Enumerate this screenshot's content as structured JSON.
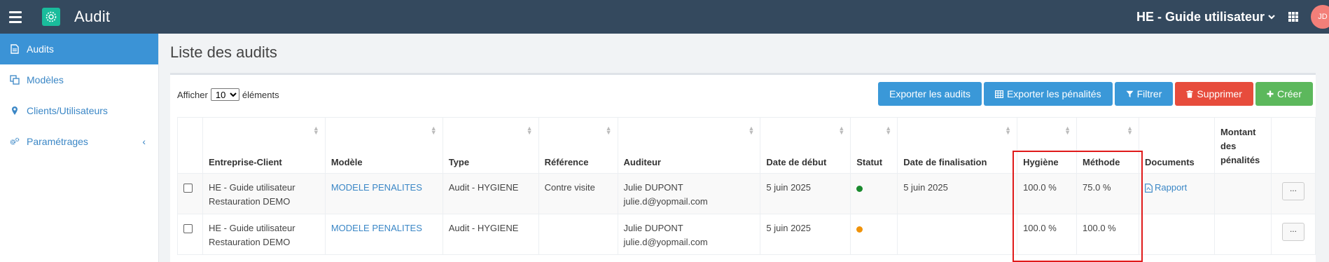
{
  "app": {
    "title": "Audit",
    "organization": "HE - Guide utilisateur",
    "avatar_initials": "JD"
  },
  "sidebar": {
    "items": [
      {
        "label": "Audits",
        "icon": "document-icon",
        "active": true
      },
      {
        "label": "Modèles",
        "icon": "copy-icon",
        "active": false
      },
      {
        "label": "Clients/Utilisateurs",
        "icon": "map-marker-icon",
        "active": false
      },
      {
        "label": "Paramétrages",
        "icon": "gears-icon",
        "active": false,
        "chevron": "‹"
      }
    ]
  },
  "page": {
    "title": "Liste des audits"
  },
  "list_controls": {
    "show_prefix": "Afficher",
    "page_size": "10",
    "show_suffix": "éléments"
  },
  "toolbar": {
    "export_audits": "Exporter les audits",
    "export_penalties": "Exporter les pénalités",
    "filter": "Filtrer",
    "delete": "Supprimer",
    "create": "Créer"
  },
  "table": {
    "columns": [
      "Entreprise-Client",
      "Modèle",
      "Type",
      "Référence",
      "Auditeur",
      "Date de début",
      "Statut",
      "Date de finalisation",
      "Hygiène",
      "Méthode",
      "Documents",
      "Montant des pénalités"
    ],
    "rows": [
      {
        "client_line1": "HE - Guide utilisateur",
        "client_line2": "Restauration DEMO",
        "model": "MODELE PENALITES",
        "type": "Audit - HYGIENE",
        "reference": "Contre visite",
        "auditor_name": "Julie DUPONT",
        "auditor_email": "julie.d@yopmail.com",
        "start_date": "5 juin 2025",
        "status_color": "#1a8a2e",
        "end_date": "5 juin 2025",
        "hygiene": "100.0 %",
        "method": "75.0 %",
        "document": "Rapport",
        "penalties": "",
        "more": "..."
      },
      {
        "client_line1": "HE - Guide utilisateur",
        "client_line2": "Restauration DEMO",
        "model": "MODELE PENALITES",
        "type": "Audit - HYGIENE",
        "reference": "",
        "auditor_name": "Julie DUPONT",
        "auditor_email": "julie.d@yopmail.com",
        "start_date": "5 juin 2025",
        "status_color": "#f0930a",
        "end_date": "",
        "hygiene": "100.0 %",
        "method": "100.0 %",
        "document": "",
        "penalties": "",
        "more": "..."
      }
    ]
  }
}
